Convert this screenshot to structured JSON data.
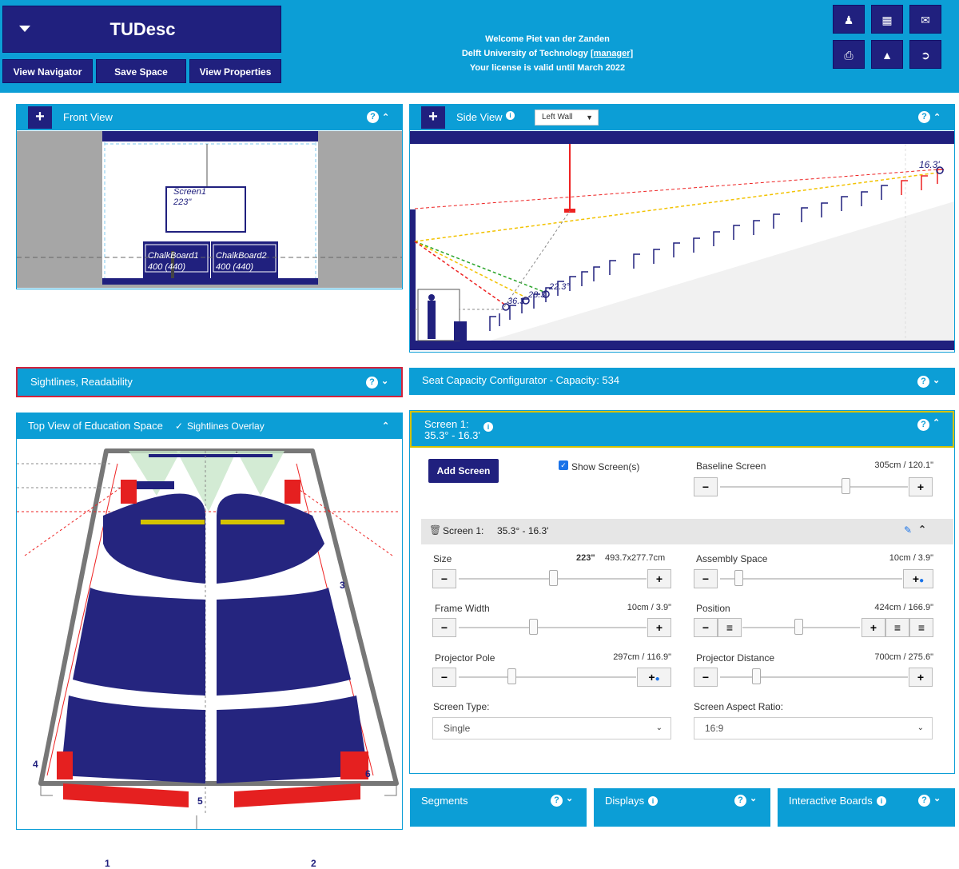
{
  "app": {
    "title": "TUDesc",
    "buttons": [
      "View Navigator",
      "Save Space",
      "View Properties"
    ],
    "welcome_line1": "Welcome Piet van der Zanden",
    "welcome_line2_prefix": "Delft University of Technology ",
    "welcome_line2_link": "[manager]",
    "welcome_line3": "Your license is valid until March 2022",
    "icons_top": [
      "user-icon",
      "calculator-icon",
      "mail-icon"
    ],
    "icons_bottom": [
      "print-icon",
      "lock-icon",
      "logout-icon"
    ]
  },
  "front_view": {
    "title": "Front View",
    "screen_label": "Screen1",
    "screen_size": "223\"",
    "board1_name": "ChalkBoard1",
    "board1_size": "400 (440)",
    "board2_name": "ChalkBoard2",
    "board2_size": "400 (440)"
  },
  "side_view": {
    "title": "Side View",
    "wall_select": "Left Wall",
    "angles": [
      "16.3'",
      "22.3°",
      "28.3",
      "36.3"
    ]
  },
  "sightlines": {
    "title": "Sightlines, Readability"
  },
  "seat_config": {
    "title": "Seat Capacity Configurator - Capacity: 534"
  },
  "top_view": {
    "title": "Top View of Education Space",
    "overlay_label": "Sightlines Overlay",
    "overlay_checked": true,
    "numbers": [
      "1",
      "2",
      "3",
      "4",
      "5",
      "6"
    ]
  },
  "screen_panel": {
    "title_line1": "Screen 1:",
    "title_line2": "35.3° - 16.3'",
    "add_screen": "Add Screen",
    "show_screens": "Show Screen(s)",
    "show_screens_checked": true,
    "baseline_label": "Baseline Screen",
    "baseline_value": "305cm / 120.1\"",
    "baseline_level": 0.8,
    "screen_row_label": "Screen 1:",
    "screen_row_value": "35.3° - 16.3'",
    "size_label": "Size",
    "size_value_bold": "223\"",
    "size_value": "493.7x277.7cm",
    "size_level": 0.5,
    "assembly_label": "Assembly Space",
    "assembly_value": "10cm / 3.9\"",
    "assembly_level": 0.05,
    "frame_label": "Frame Width",
    "frame_value": "10cm / 3.9\"",
    "frame_level": 0.4,
    "position_label": "Position",
    "position_value": "424cm / 166.9\"",
    "position_level": 0.5,
    "pole_label": "Projector Pole",
    "pole_value": "297cm / 116.9\"",
    "pole_level": 0.3,
    "distance_label": "Projector Distance",
    "distance_value": "700cm / 275.6\"",
    "distance_level": 0.2,
    "type_label": "Screen Type:",
    "type_value": "Single",
    "aspect_label": "Screen Aspect Ratio:",
    "aspect_value": "16:9",
    "minus": "−",
    "plus": "+"
  },
  "bottom_tabs": [
    "Segments",
    "Displays",
    "Interactive Boards"
  ],
  "colors": {
    "accent": "#0c9ed6",
    "navy": "#20207e",
    "seat": "#25257f",
    "seat_red": "#e52020",
    "highlight": "#d4c200"
  }
}
